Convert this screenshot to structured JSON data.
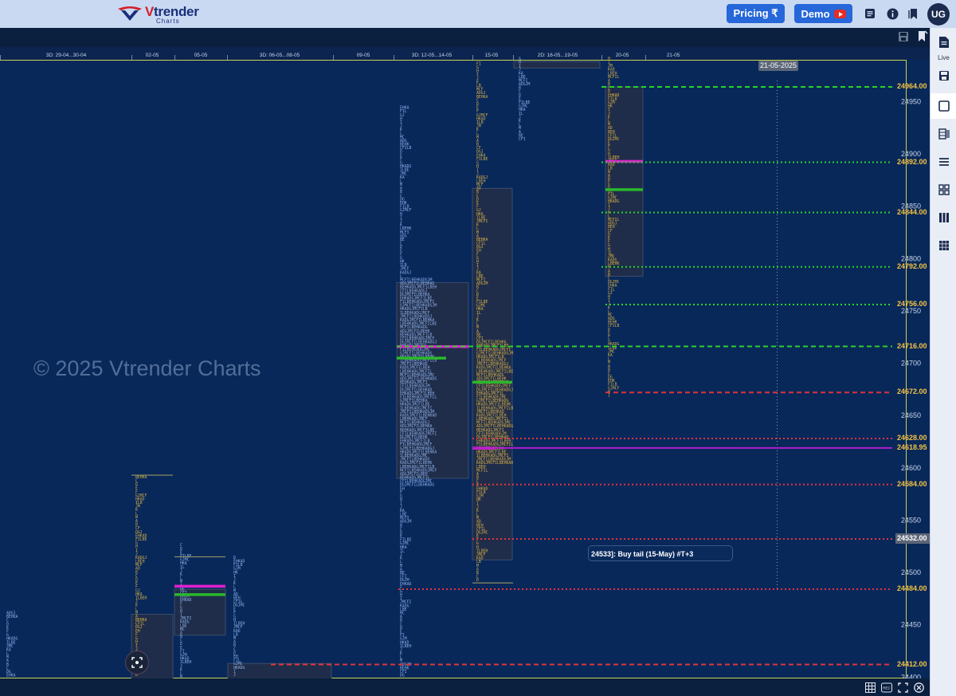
{
  "brand": {
    "name_v": "V",
    "name_rest": "trender",
    "sub": "Charts"
  },
  "header": {
    "pricing_label": "Pricing ₹",
    "demo_label": "Demo",
    "avatar_initials": "UG"
  },
  "sidebar": {
    "live_label": "Live"
  },
  "chart": {
    "watermark": "© 2025 Vtrender Charts",
    "hover_date": "21-05-2025",
    "annotation": "24533]: Buy tail (15-May) #T+3",
    "session_labels": [
      {
        "text": "3D: 29-04...30-04"
      },
      {
        "text": "02-05"
      },
      {
        "text": "05-05"
      },
      {
        "text": "3D: 06-05...08-05"
      },
      {
        "text": "09-05"
      },
      {
        "text": "3D: 12-05...14-05"
      },
      {
        "text": "15-05"
      },
      {
        "text": "2D: 16-05...19-05"
      },
      {
        "text": "20-05"
      },
      {
        "text": "21-05"
      }
    ],
    "price_axis": [
      {
        "label": "24950"
      },
      {
        "label": "24900"
      },
      {
        "label": "24850"
      },
      {
        "label": "24800"
      },
      {
        "label": "24750"
      },
      {
        "label": "24700"
      },
      {
        "label": "24650"
      },
      {
        "label": "24600"
      },
      {
        "label": "24550"
      },
      {
        "label": "24500"
      },
      {
        "label": "24450"
      },
      {
        "label": "24400"
      }
    ],
    "levels": [
      {
        "label": "24964.00",
        "color": "#f5c242",
        "line": "#29d229",
        "style": "dash"
      },
      {
        "label": "24892.00",
        "color": "#f5c242",
        "line": "#29d229",
        "style": "dot"
      },
      {
        "label": "24844.00",
        "color": "#f5c242",
        "line": "#29d229",
        "style": "dot"
      },
      {
        "label": "24792.00",
        "color": "#f5c242",
        "line": "#29d229",
        "style": "dot"
      },
      {
        "label": "24756.00",
        "color": "#f5c242",
        "line": "#29d229",
        "style": "dot"
      },
      {
        "label": "24716.00",
        "color": "#f5c242",
        "line": "#29d229",
        "style": "dash"
      },
      {
        "label": "24672.00",
        "color": "#f5c242",
        "line": "#e5323b",
        "style": "dash"
      },
      {
        "label": "24628.00",
        "color": "#f5c242",
        "line": "#e5323b",
        "style": "dot"
      },
      {
        "label": "24618.95",
        "color": "#f5c242",
        "line": "#b01cd0",
        "style": "solid"
      },
      {
        "label": "24584.00",
        "color": "#f5c242",
        "line": "#e5323b",
        "style": "dot"
      },
      {
        "label": "24532.00",
        "color": "#f5c242",
        "line": "#e5323b",
        "style": "dot"
      },
      {
        "label": "24484.00",
        "color": "#f5c242",
        "line": "#e5323b",
        "style": "dot"
      },
      {
        "label": "24412.00",
        "color": "#f5c242",
        "line": "#e5323b",
        "style": "dash"
      }
    ]
  },
  "colors": {
    "background": "#08285a",
    "accent": "#2667d9",
    "poc_magenta": "#e020d0",
    "poc_green": "#2bb82b",
    "tpo_letters": "#9fc3ff",
    "va_box": "#1f2d4a"
  }
}
